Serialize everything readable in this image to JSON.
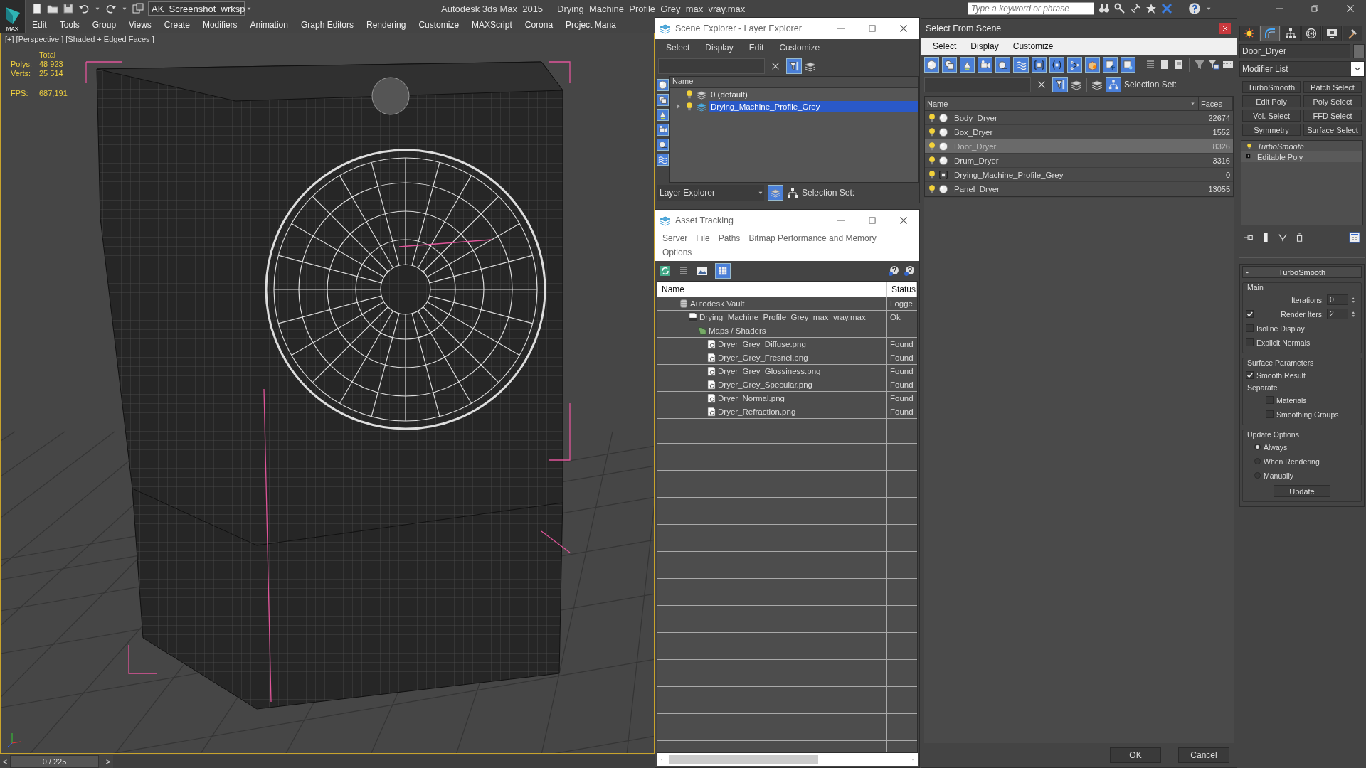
{
  "app": {
    "logo": "MAX",
    "workspace": "AK_Screenshot_wrksp",
    "product": "Autodesk 3ds Max  2015",
    "file": "Drying_Machine_Profile_Grey_max_vray.max",
    "search": {
      "placeholder": "Type a keyword or phrase"
    }
  },
  "menu": [
    "Edit",
    "Tools",
    "Group",
    "Views",
    "Create",
    "Modifiers",
    "Animation",
    "Graph Editors",
    "Rendering",
    "Customize",
    "MAXScript",
    "Corona",
    "Project Mana"
  ],
  "viewport": {
    "label": "[+] [Perspective ] [Shaded + Edged Faces ]",
    "stats_header": "Total",
    "stats": [
      {
        "label": "Polys:",
        "value": "48 923"
      },
      {
        "label": "Verts:",
        "value": "25 514"
      }
    ],
    "fps": {
      "label": "FPS:",
      "value": "687,191"
    }
  },
  "timeline": {
    "prev": "<",
    "frame": "0 / 225",
    "next": ">"
  },
  "scene_explorer": {
    "title": "Scene Explorer - Layer Explorer",
    "menu": [
      "Select",
      "Display",
      "Edit",
      "Customize"
    ],
    "column": "Name",
    "layers": [
      {
        "name": "0 (default)",
        "expandable": false,
        "selected": false
      },
      {
        "name": "Drying_Machine_Profile_Grey",
        "expandable": true,
        "selected": true
      }
    ],
    "explorer_type": "Layer Explorer",
    "selection_set": "Selection Set:"
  },
  "asset_tracking": {
    "title": "Asset Tracking",
    "menu": [
      "Server",
      "File",
      "Paths",
      "Bitmap Performance and Memory",
      "Options"
    ],
    "columns": [
      "Name",
      "Status"
    ],
    "rows": [
      {
        "kind": "vault",
        "name": "Autodesk Vault",
        "status": "Logge",
        "children": [
          {
            "kind": "max",
            "name": "Drying_Machine_Profile_Grey_max_vray.max",
            "status": "Ok",
            "children": [
              {
                "kind": "folder",
                "name": "Maps / Shaders",
                "children": [
                  {
                    "kind": "image",
                    "name": "Dryer_Grey_Diffuse.png",
                    "status": "Found"
                  },
                  {
                    "kind": "image",
                    "name": "Dryer_Grey_Fresnel.png",
                    "status": "Found"
                  },
                  {
                    "kind": "image",
                    "name": "Dryer_Grey_Glossiness.png",
                    "status": "Found"
                  },
                  {
                    "kind": "image",
                    "name": "Dryer_Grey_Specular.png",
                    "status": "Found"
                  },
                  {
                    "kind": "image",
                    "name": "Dryer_Normal.png",
                    "status": "Found"
                  },
                  {
                    "kind": "image",
                    "name": "Dryer_Refraction.png",
                    "status": "Found"
                  }
                ]
              }
            ]
          }
        ]
      }
    ]
  },
  "select_from_scene": {
    "title": "Select From Scene",
    "menu": [
      "Select",
      "Display",
      "Customize"
    ],
    "selection_set": "Selection Set:",
    "columns": [
      "Name",
      "Faces"
    ],
    "rows": [
      {
        "kind": "geometry",
        "name": "Body_Dryer",
        "faces": "22674",
        "selected": false
      },
      {
        "kind": "geometry",
        "name": "Box_Dryer",
        "faces": "1552",
        "selected": false
      },
      {
        "kind": "geometry",
        "name": "Door_Dryer",
        "faces": "8326",
        "selected": true
      },
      {
        "kind": "geometry",
        "name": "Drum_Dryer",
        "faces": "3316",
        "selected": false
      },
      {
        "kind": "group",
        "name": "Drying_Machine_Profile_Grey",
        "faces": "0",
        "selected": false
      },
      {
        "kind": "geometry",
        "name": "Panel_Dryer",
        "faces": "13055",
        "selected": false
      }
    ],
    "buttons": [
      "OK",
      "Cancel"
    ]
  },
  "command_panel": {
    "tabs": [
      {
        "kind": "create",
        "selected": false
      },
      {
        "kind": "modify",
        "selected": true
      },
      {
        "kind": "hierarchy",
        "selected": false
      },
      {
        "kind": "motion",
        "selected": false
      },
      {
        "kind": "display",
        "selected": false
      },
      {
        "kind": "utilities",
        "selected": false
      }
    ],
    "object_name": "Door_Dryer",
    "modifier_list": "Modifier List",
    "modifier_buttons": [
      "TurboSmooth",
      "Patch Select",
      "Edit Poly",
      "Poly Select",
      "Vol. Select",
      "FFD Select",
      "Symmetry",
      "Surface Select"
    ],
    "stack": [
      {
        "kind": "modifier",
        "name": "TurboSmooth"
      },
      {
        "kind": "base",
        "name": "Editable Poly"
      }
    ],
    "rollout": {
      "title": "TurboSmooth",
      "collapse": "-",
      "main": {
        "title": "Main",
        "iterations": {
          "label": "Iterations:",
          "value": "0"
        },
        "render_iters": {
          "label": "Render Iters:",
          "value": "2",
          "checked": true
        },
        "options": [
          {
            "label": "Isoline Display",
            "checked": false
          },
          {
            "label": "Explicit Normals",
            "checked": false
          }
        ]
      },
      "surface": {
        "title": "Surface Parameters",
        "smooth_result": {
          "label": "Smooth Result",
          "checked": true
        },
        "separate": "Separate",
        "separate_options": [
          {
            "label": "Materials",
            "checked": false
          },
          {
            "label": "Smoothing Groups",
            "checked": false
          }
        ]
      },
      "update": {
        "title": "Update Options",
        "modes": [
          {
            "label": "Always",
            "selected": true
          },
          {
            "label": "When Rendering",
            "selected": false
          },
          {
            "label": "Manually",
            "selected": false
          }
        ],
        "button": "Update"
      }
    }
  }
}
